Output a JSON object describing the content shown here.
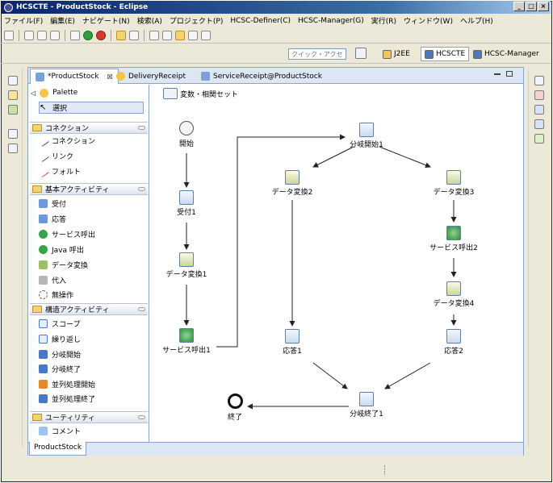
{
  "window": {
    "title": "HCSCTE - ProductStock - Eclipse",
    "buttons": [
      "_",
      "□",
      "×"
    ]
  },
  "menubar": [
    "ファイル(F)",
    "編集(E)",
    "ナビゲート(N)",
    "検索(A)",
    "プロジェクト(P)",
    "HCSC-Definer(C)",
    "HCSC-Manager(G)",
    "実行(R)",
    "ウィンドウ(W)",
    "ヘルプ(H)"
  ],
  "quick_access": {
    "placeholder": "クイック・アクセス"
  },
  "perspectives": [
    {
      "label": "J2EE",
      "active": false
    },
    {
      "label": "HCSCTE",
      "active": true
    },
    {
      "label": "HCSC-Manager",
      "active": false
    }
  ],
  "tabs": [
    {
      "label": "*ProductStock",
      "active": true,
      "close": "☒"
    },
    {
      "label": "DeliveryReceipt",
      "active": false
    },
    {
      "label": "ServiceReceipt@ProductStock",
      "active": false
    }
  ],
  "palette": {
    "title": "Palette",
    "select_label": "選択",
    "drawers": [
      {
        "label": "コネクション",
        "items": [
          "コネクション",
          "リンク",
          "フォルト"
        ]
      },
      {
        "label": "基本アクティビティ",
        "items": [
          "受付",
          "応答",
          "サービス呼出",
          "Java 呼出",
          "データ変換",
          "代入",
          "無操作"
        ]
      },
      {
        "label": "構造アクティビティ",
        "items": [
          "スコープ",
          "繰り返し",
          "分岐開始",
          "分岐終了",
          "並列処理開始",
          "並列処理終了"
        ]
      },
      {
        "label": "ユーティリティ",
        "items": [
          "コメント"
        ]
      }
    ]
  },
  "canvas": {
    "variables_label": "変数・相関セット",
    "nodes": {
      "start": "開始",
      "receive": "受付1",
      "transform1": "データ変換1",
      "invoke1": "サービス呼出1",
      "branch_start": "分岐開始1",
      "transform2": "データ変換2",
      "transform3": "データ変換3",
      "invoke2": "サービス呼出2",
      "transform4": "データ変換4",
      "reply1": "応答1",
      "reply2": "応答2",
      "branch_end": "分岐終了1",
      "end": "終了"
    }
  },
  "bottom_tab": {
    "label": "ProductStock"
  }
}
